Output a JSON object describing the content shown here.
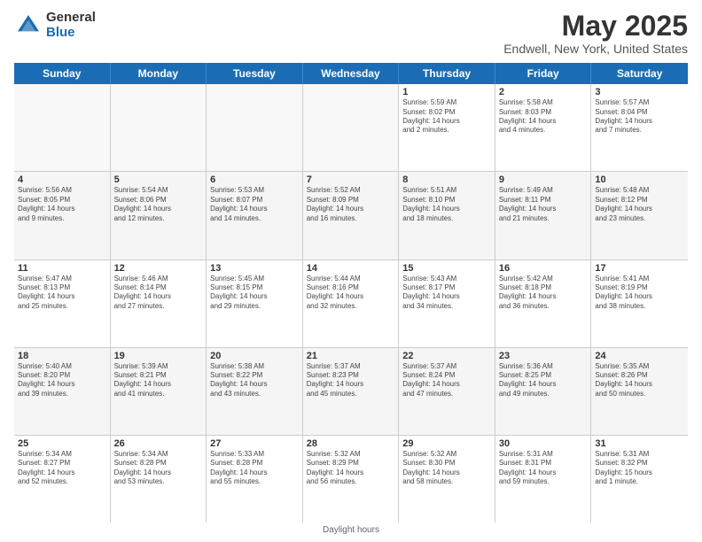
{
  "header": {
    "logo_general": "General",
    "logo_blue": "Blue",
    "title": "May 2025",
    "subtitle": "Endwell, New York, United States"
  },
  "days": [
    "Sunday",
    "Monday",
    "Tuesday",
    "Wednesday",
    "Thursday",
    "Friday",
    "Saturday"
  ],
  "footer": "Daylight hours",
  "weeks": [
    [
      {
        "day": "",
        "info": ""
      },
      {
        "day": "",
        "info": ""
      },
      {
        "day": "",
        "info": ""
      },
      {
        "day": "",
        "info": ""
      },
      {
        "day": "1",
        "info": "Sunrise: 5:59 AM\nSunset: 8:02 PM\nDaylight: 14 hours\nand 2 minutes."
      },
      {
        "day": "2",
        "info": "Sunrise: 5:58 AM\nSunset: 8:03 PM\nDaylight: 14 hours\nand 4 minutes."
      },
      {
        "day": "3",
        "info": "Sunrise: 5:57 AM\nSunset: 8:04 PM\nDaylight: 14 hours\nand 7 minutes."
      }
    ],
    [
      {
        "day": "4",
        "info": "Sunrise: 5:56 AM\nSunset: 8:05 PM\nDaylight: 14 hours\nand 9 minutes."
      },
      {
        "day": "5",
        "info": "Sunrise: 5:54 AM\nSunset: 8:06 PM\nDaylight: 14 hours\nand 12 minutes."
      },
      {
        "day": "6",
        "info": "Sunrise: 5:53 AM\nSunset: 8:07 PM\nDaylight: 14 hours\nand 14 minutes."
      },
      {
        "day": "7",
        "info": "Sunrise: 5:52 AM\nSunset: 8:09 PM\nDaylight: 14 hours\nand 16 minutes."
      },
      {
        "day": "8",
        "info": "Sunrise: 5:51 AM\nSunset: 8:10 PM\nDaylight: 14 hours\nand 18 minutes."
      },
      {
        "day": "9",
        "info": "Sunrise: 5:49 AM\nSunset: 8:11 PM\nDaylight: 14 hours\nand 21 minutes."
      },
      {
        "day": "10",
        "info": "Sunrise: 5:48 AM\nSunset: 8:12 PM\nDaylight: 14 hours\nand 23 minutes."
      }
    ],
    [
      {
        "day": "11",
        "info": "Sunrise: 5:47 AM\nSunset: 8:13 PM\nDaylight: 14 hours\nand 25 minutes."
      },
      {
        "day": "12",
        "info": "Sunrise: 5:46 AM\nSunset: 8:14 PM\nDaylight: 14 hours\nand 27 minutes."
      },
      {
        "day": "13",
        "info": "Sunrise: 5:45 AM\nSunset: 8:15 PM\nDaylight: 14 hours\nand 29 minutes."
      },
      {
        "day": "14",
        "info": "Sunrise: 5:44 AM\nSunset: 8:16 PM\nDaylight: 14 hours\nand 32 minutes."
      },
      {
        "day": "15",
        "info": "Sunrise: 5:43 AM\nSunset: 8:17 PM\nDaylight: 14 hours\nand 34 minutes."
      },
      {
        "day": "16",
        "info": "Sunrise: 5:42 AM\nSunset: 8:18 PM\nDaylight: 14 hours\nand 36 minutes."
      },
      {
        "day": "17",
        "info": "Sunrise: 5:41 AM\nSunset: 8:19 PM\nDaylight: 14 hours\nand 38 minutes."
      }
    ],
    [
      {
        "day": "18",
        "info": "Sunrise: 5:40 AM\nSunset: 8:20 PM\nDaylight: 14 hours\nand 39 minutes."
      },
      {
        "day": "19",
        "info": "Sunrise: 5:39 AM\nSunset: 8:21 PM\nDaylight: 14 hours\nand 41 minutes."
      },
      {
        "day": "20",
        "info": "Sunrise: 5:38 AM\nSunset: 8:22 PM\nDaylight: 14 hours\nand 43 minutes."
      },
      {
        "day": "21",
        "info": "Sunrise: 5:37 AM\nSunset: 8:23 PM\nDaylight: 14 hours\nand 45 minutes."
      },
      {
        "day": "22",
        "info": "Sunrise: 5:37 AM\nSunset: 8:24 PM\nDaylight: 14 hours\nand 47 minutes."
      },
      {
        "day": "23",
        "info": "Sunrise: 5:36 AM\nSunset: 8:25 PM\nDaylight: 14 hours\nand 49 minutes."
      },
      {
        "day": "24",
        "info": "Sunrise: 5:35 AM\nSunset: 8:26 PM\nDaylight: 14 hours\nand 50 minutes."
      }
    ],
    [
      {
        "day": "25",
        "info": "Sunrise: 5:34 AM\nSunset: 8:27 PM\nDaylight: 14 hours\nand 52 minutes."
      },
      {
        "day": "26",
        "info": "Sunrise: 5:34 AM\nSunset: 8:28 PM\nDaylight: 14 hours\nand 53 minutes."
      },
      {
        "day": "27",
        "info": "Sunrise: 5:33 AM\nSunset: 8:28 PM\nDaylight: 14 hours\nand 55 minutes."
      },
      {
        "day": "28",
        "info": "Sunrise: 5:32 AM\nSunset: 8:29 PM\nDaylight: 14 hours\nand 56 minutes."
      },
      {
        "day": "29",
        "info": "Sunrise: 5:32 AM\nSunset: 8:30 PM\nDaylight: 14 hours\nand 58 minutes."
      },
      {
        "day": "30",
        "info": "Sunrise: 5:31 AM\nSunset: 8:31 PM\nDaylight: 14 hours\nand 59 minutes."
      },
      {
        "day": "31",
        "info": "Sunrise: 5:31 AM\nSunset: 8:32 PM\nDaylight: 15 hours\nand 1 minute."
      }
    ]
  ]
}
